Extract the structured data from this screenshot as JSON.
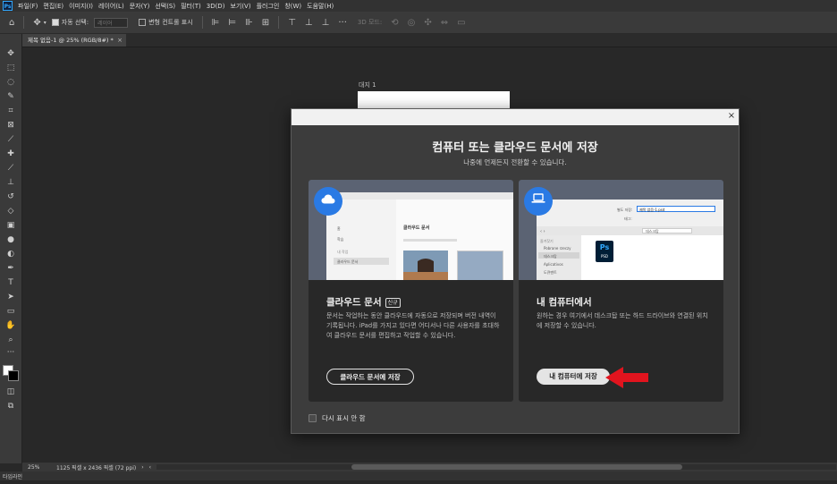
{
  "app": {
    "logo": "Ps",
    "menu": [
      "파일(F)",
      "편집(E)",
      "이미지(I)",
      "레이어(L)",
      "문자(Y)",
      "선택(S)",
      "필터(T)",
      "3D(D)",
      "보기(V)",
      "플러그인",
      "창(W)",
      "도움말(H)"
    ]
  },
  "options_bar": {
    "auto_select_label": "자동 선택:",
    "auto_select_value": "레이어",
    "transform_controls_label": "변형 컨트롤 표시",
    "mode_3d_label": "3D 모드:"
  },
  "document_tab": {
    "title": "제목 없음-1 @ 25% (RGB/8#) *",
    "close": "×"
  },
  "canvas": {
    "artboard_label": "대지 1"
  },
  "status_bar": {
    "zoom": "25%",
    "doc_info": "1125 픽셀 x 2436 픽셀 (72 ppi)",
    "arrow": "›",
    "left_arrow": "‹"
  },
  "timeline": {
    "label": "타임라인"
  },
  "dialog": {
    "close": "×",
    "title": "컴퓨터 또는 클라우드 문서에 저장",
    "subtitle": "나중에 언제든지 전환할 수 있습니다.",
    "cloud_card": {
      "icon": "cloud-icon",
      "title": "클라우드 문서",
      "badge": "신규",
      "description": "문서는 작업하는 동안 클라우드에 자동으로 저장되며 버전 내역이 기록됩니다. iPad를 가지고 있다면 어디서나 다른 사용자를 초대하여 클라우드 문서를 편집하고 작업할 수 있습니다.",
      "button": "클라우드 문서에 저장",
      "mock": {
        "title": "클라우드 문서",
        "side_items": [
          "홈",
          "학습",
          "내 작업",
          "클라우드 문서"
        ]
      }
    },
    "local_card": {
      "icon": "laptop-icon",
      "title": "내 컴퓨터에서",
      "description": "원하는 경우 여기에서 데스크탑 또는 하드 드라이브와 연결된 위치에 저장할 수 있습니다.",
      "button": "내 컴퓨터에 저장",
      "mock": {
        "save_as_label": "별도 저장:",
        "filename": "제목 없음-1.psd",
        "tags_label": "태그:",
        "location": "데스크탑",
        "favorites": "즐겨찾기",
        "side_items": [
          "Pobrane rzeczy",
          "데스크탑",
          "Aplicativos",
          "도큐멘트"
        ],
        "file_icon": "Ps",
        "file_ext": "PSD"
      }
    },
    "dont_show_again": "다시 표시 안 함"
  },
  "colors": {
    "accent_blue": "#2a7ae4",
    "arrow_red": "#e1141e",
    "ps_blue": "#31a8ff"
  }
}
